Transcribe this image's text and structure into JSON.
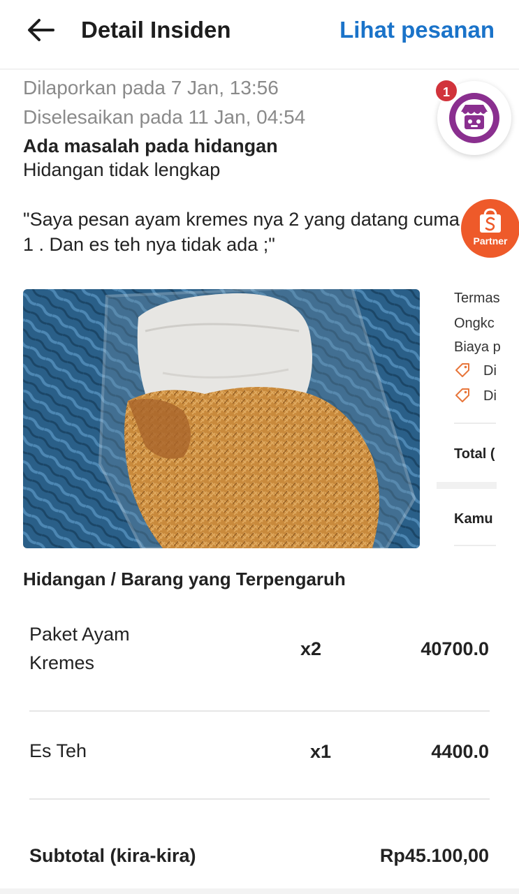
{
  "header": {
    "title": "Detail Insiden",
    "action_label": "Lihat pesanan",
    "back_icon": "arrow-left-icon"
  },
  "incident": {
    "reported": "Dilaporkan pada 7 Jan, 13:56",
    "resolved": "Diselesaikan pada 11 Jan, 04:54",
    "category": "Ada masalah pada hidangan",
    "subcategory": "Hidangan tidak lengkap",
    "customer_note": "\"Saya pesan ayam kremes nya 2 yang datang cuma 1 . Dan es teh nya tidak ada ;\""
  },
  "floating": {
    "store_badge_count": "1",
    "store_icon": "store-icon",
    "partner_label": "Partner",
    "partner_icon": "shopee-bag-icon"
  },
  "order_peek": {
    "line1": "Termas",
    "line2": "Ongkc",
    "line3": "Biaya p",
    "discount1": "Di",
    "discount2": "Di",
    "total": "Total (",
    "kamu": "Kamu"
  },
  "affected": {
    "title": "Hidangan / Barang yang Terpengaruh",
    "items": [
      {
        "name": "Paket Ayam Kremes",
        "qty": "x2",
        "price": "40700.0"
      },
      {
        "name": "Es Teh",
        "qty": "x1",
        "price": "4400.0"
      }
    ],
    "subtotal_label": "Subtotal (kira-kira)",
    "subtotal_value": "Rp45.100,00"
  },
  "colors": {
    "accent_blue": "#1a73c9",
    "badge_red": "#d1333b",
    "store_purple": "#8a2f8f",
    "partner_orange": "#ee5a2a"
  }
}
